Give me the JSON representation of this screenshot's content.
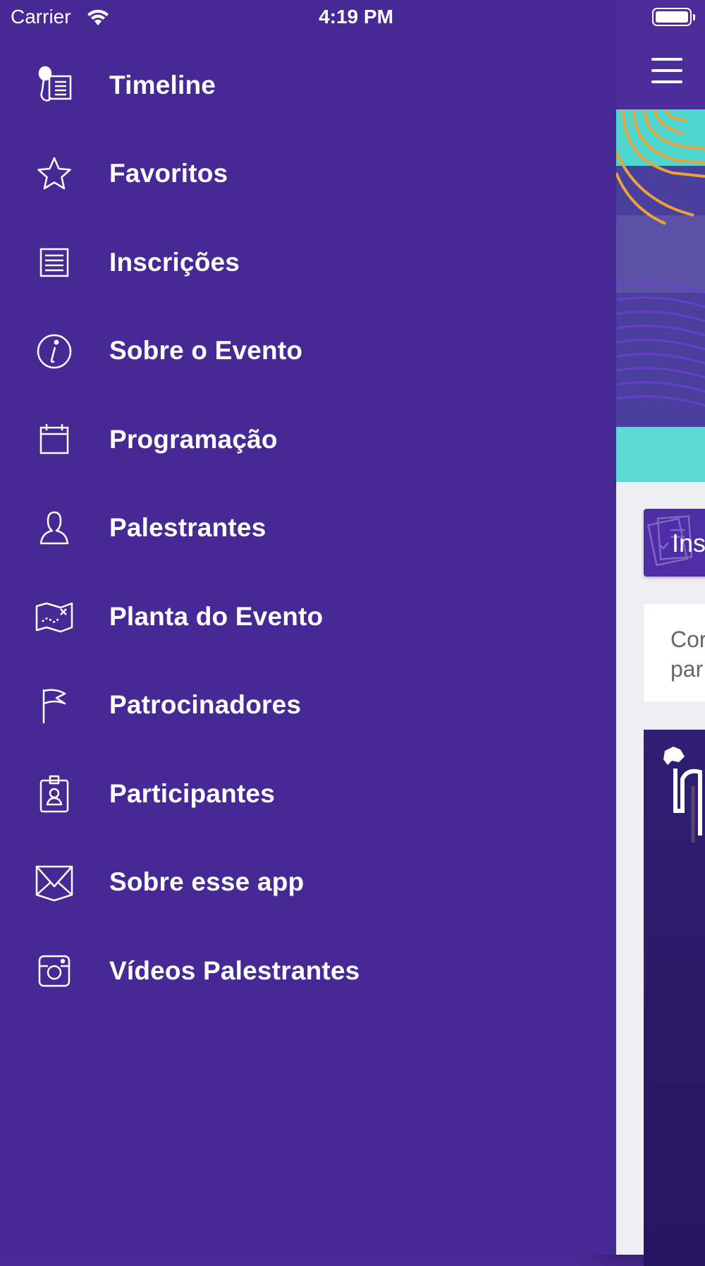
{
  "status_bar": {
    "carrier": "Carrier",
    "time": "4:19 PM"
  },
  "drawer": {
    "background_color": "#472996",
    "items": [
      {
        "label": "Timeline",
        "icon": "microphone-script-icon"
      },
      {
        "label": "Favoritos",
        "icon": "star-icon"
      },
      {
        "label": "Inscrições",
        "icon": "document-list-icon"
      },
      {
        "label": "Sobre o Evento",
        "icon": "info-icon"
      },
      {
        "label": "Programação",
        "icon": "calendar-icon"
      },
      {
        "label": "Palestrantes",
        "icon": "person-icon"
      },
      {
        "label": "Planta do Evento",
        "icon": "map-icon"
      },
      {
        "label": "Patrocinadores",
        "icon": "flag-icon"
      },
      {
        "label": "Participantes",
        "icon": "badge-icon"
      },
      {
        "label": "Sobre esse app",
        "icon": "envelope-icon"
      },
      {
        "label": "Vídeos Palestrantes",
        "icon": "camera-icon"
      }
    ]
  },
  "main": {
    "inscricoes_card_label": "Ins",
    "text_card_lines": [
      "Cor",
      "par"
    ]
  },
  "colors": {
    "header_purple": "#4b2c98",
    "banner_teal": "#5fd9d4",
    "banner_orange": "#e8a33a"
  }
}
